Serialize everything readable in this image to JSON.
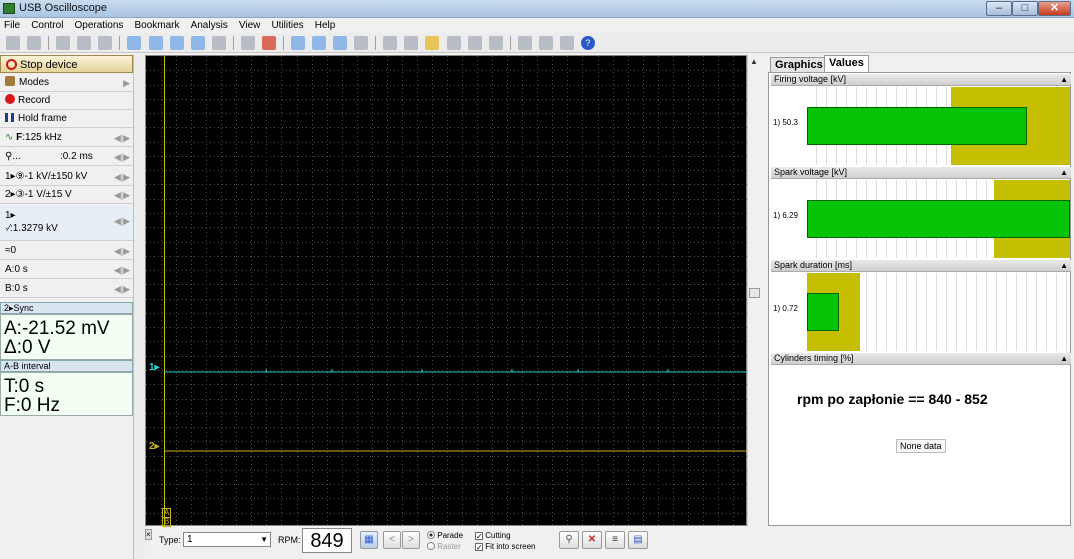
{
  "window": {
    "title": "USB Oscilloscope",
    "menu": [
      "File",
      "Control",
      "Operations",
      "Bookmark",
      "Analysis",
      "View",
      "Utilities",
      "Help"
    ]
  },
  "left": {
    "stop_device": "Stop device",
    "modes": "Modes",
    "record": "Record",
    "hold_frame": "Hold frame",
    "freq_label": "F",
    "freq_value": ":125 kHz",
    "zoom_label": "...",
    "timebase": ":0.2 ms",
    "ch1": "1▸⑨-1 kV/±150 kV",
    "ch2": "2▸③-1 V/±15 V",
    "trig_line1": "1▸",
    "trig_line2": "·⁄:1.3279 kV",
    "trig_offset": "0",
    "cursor_a": "A:0 s",
    "cursor_b": "B:0 s",
    "sync_header": "2▸Sync",
    "sync_a": "A:-21.52 mV",
    "sync_delta": "Δ:0 V",
    "ab_header": "A-B interval",
    "ab_t": "T:0 s",
    "ab_f": "F:0 Hz"
  },
  "scope": {
    "ch1_marker": "1▸",
    "ch2_marker": "2▸",
    "cursor_a_marker": "A",
    "cursor_b_marker": "B",
    "ch1_color": "#33cccc",
    "ch2_color": "#c8b020",
    "trigger_color": "#c8c800"
  },
  "bottom": {
    "type_label": "Type:",
    "type_value": "1",
    "rpm_label": "RPM:",
    "rpm_value": "849",
    "parade": "Parade",
    "raster": "Raster",
    "cutting": "Cutting",
    "fit": "Fit into screen"
  },
  "right": {
    "tab_graphics": "Graphics",
    "tab_values": "Values",
    "firing_header": "Firing voltage [kV]",
    "firing_label": "1) 50.3",
    "firing_value": 50.3,
    "spark_header": "Spark voltage [kV]",
    "spark_label": "1) 6.29",
    "spark_value": 6.29,
    "duration_header": "Spark duration [ms]",
    "duration_label": "1) 0.72",
    "duration_value": 0.72,
    "cyl_header": "Cylinders timing [%]",
    "note": "rpm po zapłonie == 840 - 852",
    "none_data": "None data",
    "bar_green": "#08c408",
    "zone_olive": "#c6be00"
  }
}
